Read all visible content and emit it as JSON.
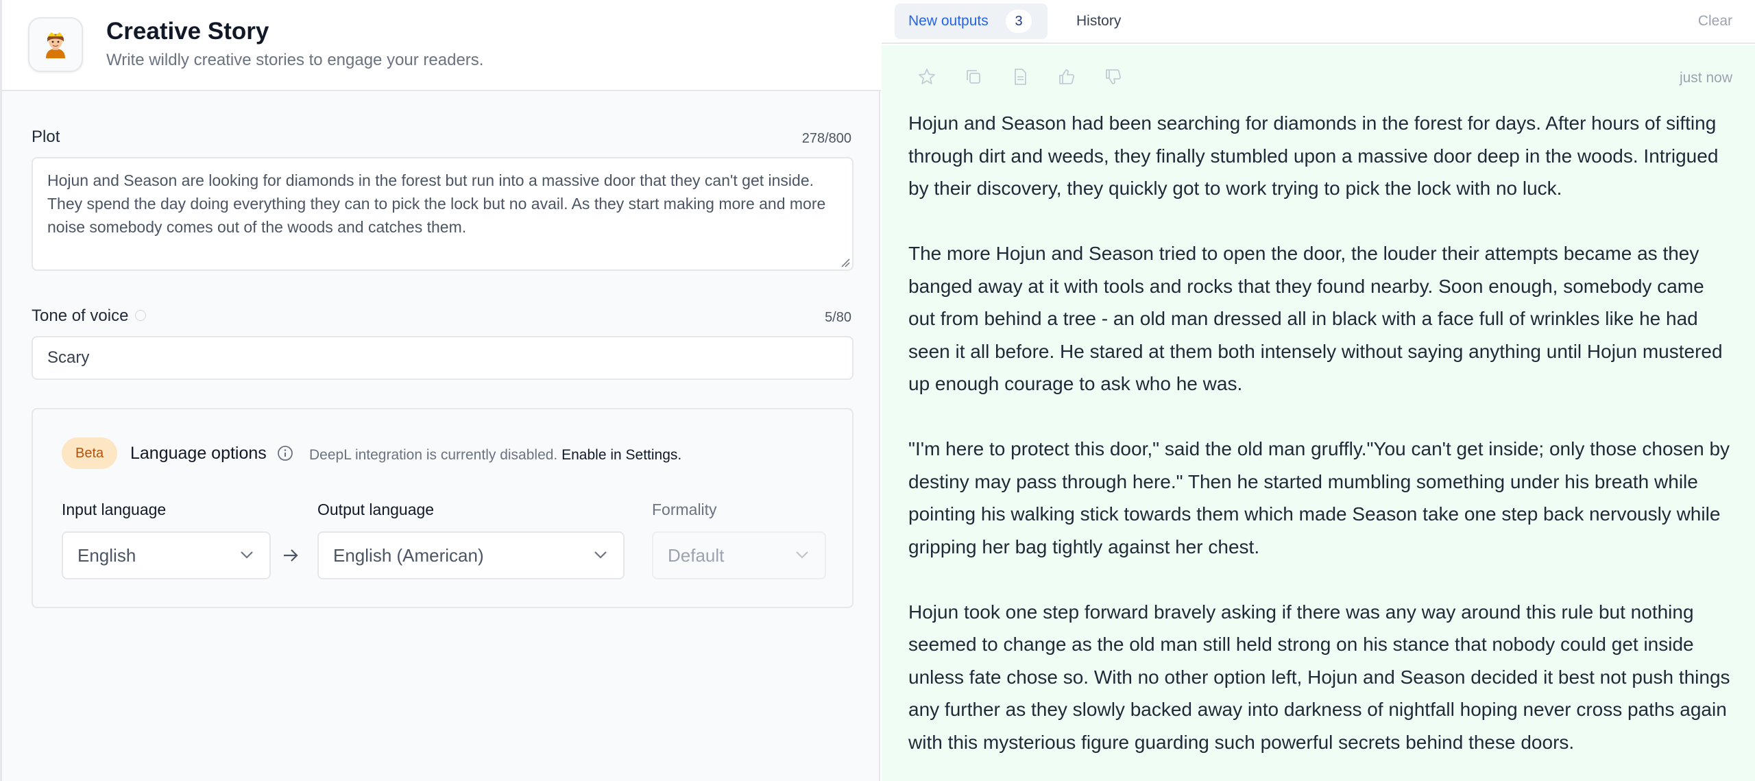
{
  "app": {
    "icon": "person-emoji-icon",
    "title": "Creative Story",
    "subtitle": "Write wildly creative stories to engage your readers."
  },
  "form": {
    "plot": {
      "label": "Plot",
      "counter": "278/800",
      "value": "Hojun and Season are looking for diamonds in the forest but run into a massive door that they can't get inside. They spend the day doing everything they can to pick the lock but no avail. As they start making more and more noise somebody comes out of the woods and catches them."
    },
    "tone": {
      "label": "Tone of voice",
      "counter": "5/80",
      "value": "Scary"
    },
    "language": {
      "badge": "Beta",
      "title": "Language options",
      "note": "DeepL integration is currently disabled.",
      "link": "Enable in Settings.",
      "input_label": "Input language",
      "input_value": "English",
      "output_label": "Output language",
      "output_value": "English (American)",
      "formality_label": "Formality",
      "formality_value": "Default"
    }
  },
  "outputs": {
    "tab_new": "New outputs",
    "tab_new_count": "3",
    "tab_history": "History",
    "clear": "Clear",
    "timestamp": "just now",
    "actions": [
      "star-icon",
      "copy-icon",
      "document-icon",
      "thumbs-up-icon",
      "thumbs-down-icon"
    ],
    "paragraphs": [
      "Hojun and Season had been searching for diamonds in the forest for days. After hours of sifting through dirt and weeds, they finally stumbled upon a massive door deep in the woods. Intrigued by their discovery, they quickly got to work trying to pick the lock with no luck.",
      "The more Hojun and Season tried to open the door, the louder their attempts became as they banged away at it with tools and rocks that they found nearby. Soon enough, somebody came out from behind a tree - an old man dressed all in black with a face full of wrinkles like he had seen it all before. He stared at them both intensely without saying anything until Hojun mustered up enough courage to ask who he was.",
      "\"I'm here to protect this door,\" said the old man gruffly.\"You can't get inside; only those chosen by destiny may pass through here.\" Then he started mumbling something under his breath while pointing his walking stick towards them which made Season take one step back nervously while gripping her bag tightly against her chest.",
      "Hojun took one step forward bravely asking if there was any way around this rule but nothing seemed to change as the old man still held strong on his stance that nobody could get inside unless fate chose so. With no other option left, Hojun and Season decided it best not push things any further as they slowly backed away into darkness of nightfall hoping never cross paths again with this mysterious figure guarding such powerful secrets behind these doors."
    ]
  },
  "colors": {
    "accent": "#2563eb",
    "output_bg": "#f0fdf4",
    "beta_bg": "#fde6c4",
    "beta_text": "#b45309"
  }
}
